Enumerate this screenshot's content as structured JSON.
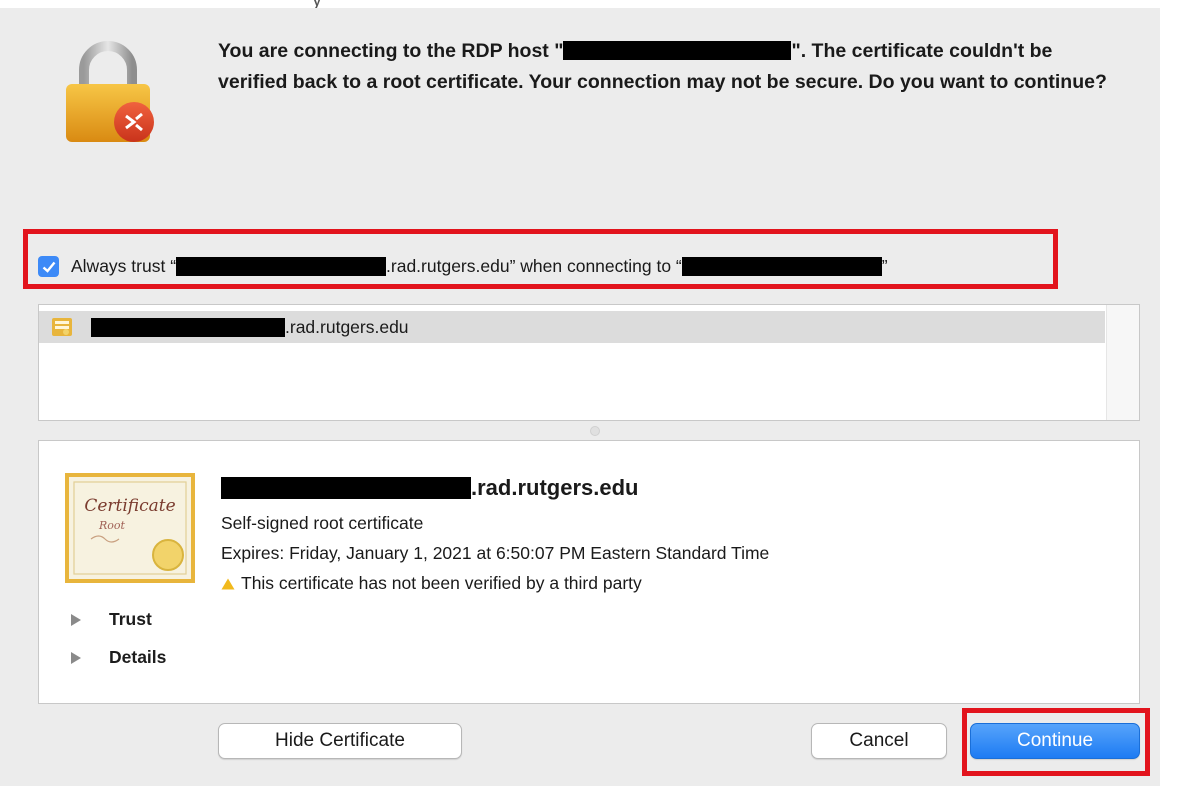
{
  "top_cut_text": "                                        y",
  "message": {
    "part1": "You are connecting to the RDP host \"",
    "part2": "\". The certificate couldn't be verified back to a root certificate. Your connection may not be secure. Do you want to continue?"
  },
  "always_trust": {
    "checked": true,
    "prefix": "Always trust “",
    "domain_suffix": ".rad.rutgers.edu” when connecting to “",
    "end_quote": "”"
  },
  "cert_list": {
    "items": [
      {
        "name_suffix": ".rad.rutgers.edu"
      }
    ]
  },
  "certificate": {
    "title_suffix": ".rad.rutgers.edu",
    "kind": "Self-signed root certificate",
    "expires": "Expires: Friday, January 1, 2021 at 6:50:07 PM Eastern Standard Time",
    "warning": "This certificate has not been verified by a third party",
    "badge_script": "Certificate",
    "badge_sub": "Root"
  },
  "sections": {
    "trust": "Trust",
    "details": "Details"
  },
  "buttons": {
    "hide_certificate": "Hide Certificate",
    "cancel": "Cancel",
    "continue": "Continue"
  },
  "colors": {
    "highlight_red": "#e2141d",
    "accent_blue": "#3d8af7"
  }
}
